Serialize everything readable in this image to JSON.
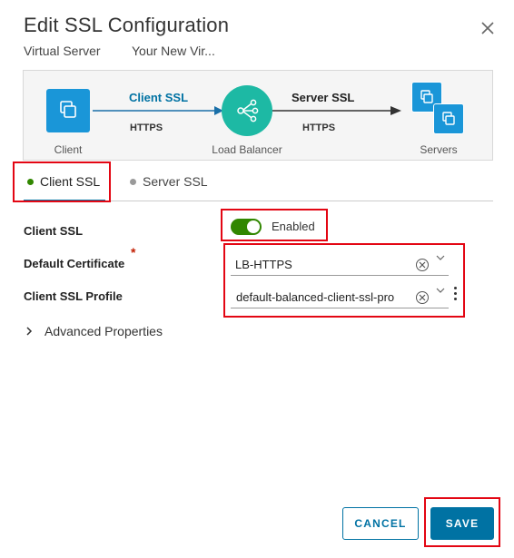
{
  "dialog": {
    "title": "Edit SSL Configuration",
    "subtitle_label": "Virtual Server",
    "subtitle_value": "Your New Vir..."
  },
  "diagram": {
    "client_label": "Client",
    "lb_label": "Load Balancer",
    "servers_label": "Servers",
    "client_ssl_link": "Client SSL",
    "client_protocol": "HTTPS",
    "server_ssl_link": "Server SSL",
    "server_protocol": "HTTPS"
  },
  "tabs": [
    {
      "label": "Client SSL",
      "active": true,
      "dot_color": "#318700"
    },
    {
      "label": "Server SSL",
      "active": false,
      "dot_color": "#9a9a9a"
    }
  ],
  "form": {
    "client_ssl_label": "Client SSL",
    "client_ssl_toggle": "Enabled",
    "default_certificate_label": "Default Certificate",
    "default_certificate_value": "LB-HTTPS",
    "client_ssl_profile_label": "Client SSL Profile",
    "client_ssl_profile_value": "default-balanced-client-ssl-pro",
    "required_mark": "*"
  },
  "advanced": {
    "label": "Advanced Properties"
  },
  "buttons": {
    "cancel": "CANCEL",
    "save": "SAVE"
  },
  "colors": {
    "accent": "#0072a3",
    "node_blue": "#1a96d8",
    "lb_teal": "#1db9a4",
    "toggle_green": "#318700",
    "highlight_red": "#e30613"
  }
}
